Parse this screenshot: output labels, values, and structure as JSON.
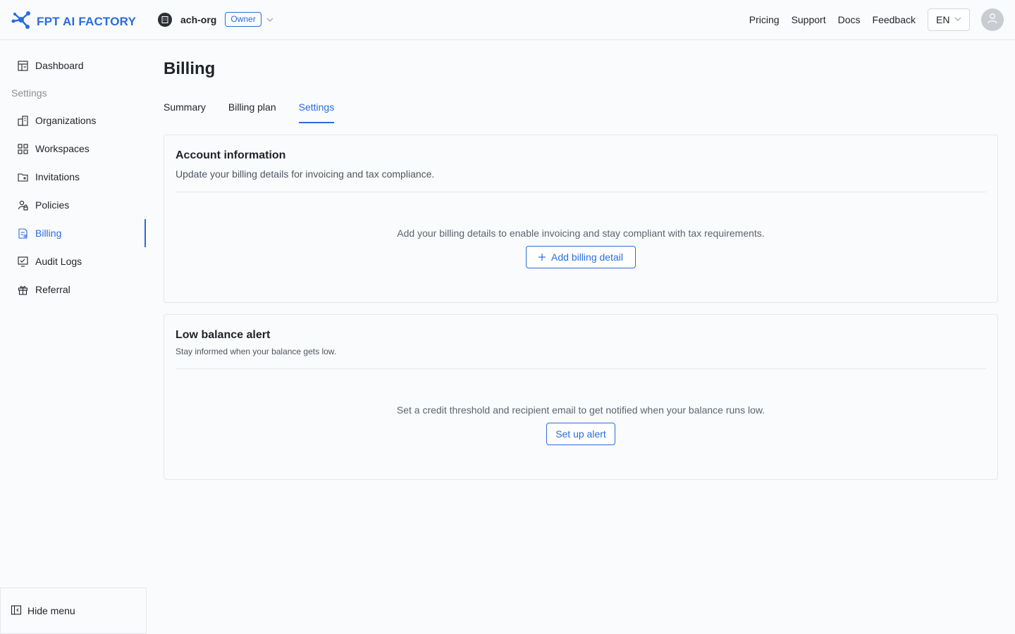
{
  "brand": {
    "name": "FPT AI FACTORY",
    "accent": "#2a6be0"
  },
  "org": {
    "name": "ach-org",
    "role": "Owner",
    "avatar_icon": "building-icon"
  },
  "topnav": {
    "links": [
      "Pricing",
      "Support",
      "Docs",
      "Feedback"
    ],
    "language": "EN"
  },
  "sidebar": {
    "dashboard": "Dashboard",
    "section_label": "Settings",
    "items": [
      {
        "label": "Organizations",
        "icon": "organization-icon"
      },
      {
        "label": "Workspaces",
        "icon": "workspace-icon"
      },
      {
        "label": "Invitations",
        "icon": "invitation-icon"
      },
      {
        "label": "Policies",
        "icon": "policy-icon"
      },
      {
        "label": "Billing",
        "icon": "billing-icon",
        "active": true
      },
      {
        "label": "Audit Logs",
        "icon": "audit-log-icon"
      },
      {
        "label": "Referral",
        "icon": "gift-icon"
      }
    ],
    "hide_menu": "Hide menu"
  },
  "page": {
    "title": "Billing",
    "tabs": [
      "Summary",
      "Billing plan",
      "Settings"
    ],
    "active_tab": "Settings"
  },
  "account_card": {
    "title": "Account information",
    "subtitle": "Update your billing details for invoicing and tax compliance.",
    "message": "Add your billing details to enable invoicing and stay compliant with tax requirements.",
    "button": "Add billing detail"
  },
  "alert_card": {
    "title": "Low balance alert",
    "subtitle": "Stay informed when your balance gets low.",
    "message": "Set a credit threshold and recipient email to get notified when your balance runs low.",
    "button": "Set up alert"
  }
}
